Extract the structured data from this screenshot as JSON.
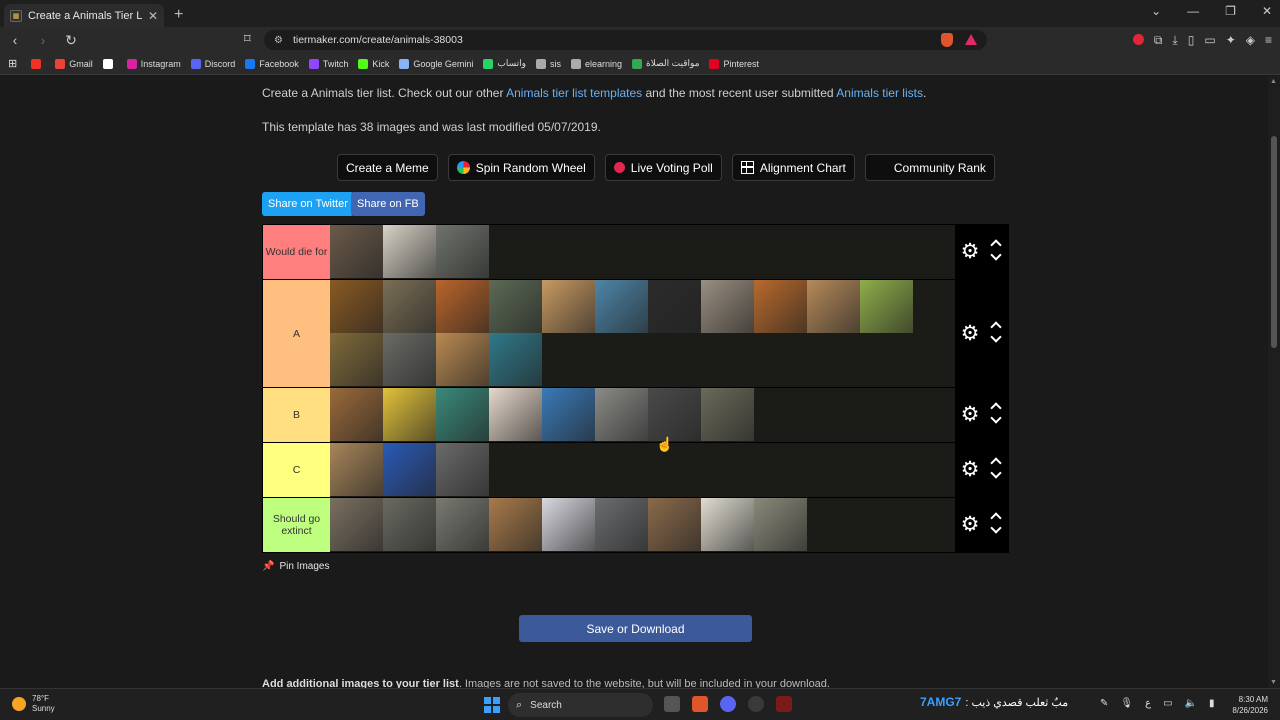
{
  "browser": {
    "tab_title": "Create a Animals Tier List - TierM",
    "tab_close": "✕",
    "new_tab": "+",
    "url": "tiermaker.com/create/animals-38003",
    "window_controls": [
      "⌄",
      "—",
      "❐",
      "✕"
    ]
  },
  "bookmarks": [
    {
      "label": "",
      "color": "#e32"
    },
    {
      "label": "Gmail",
      "color": "#ea4335"
    },
    {
      "label": "",
      "color": "#ffffff"
    },
    {
      "label": "Instagram",
      "color": "#d6249f"
    },
    {
      "label": "Discord",
      "color": "#5865f2"
    },
    {
      "label": "Facebook",
      "color": "#1877f2"
    },
    {
      "label": "Twitch",
      "color": "#9146ff"
    },
    {
      "label": "Kick",
      "color": "#53fc18"
    },
    {
      "label": "Google Gemini",
      "color": "#8ab4f8"
    },
    {
      "label": "واتساب",
      "color": "#25d366"
    },
    {
      "label": "sis",
      "color": "#aaaaaa"
    },
    {
      "label": "elearning",
      "color": "#aaaaaa"
    },
    {
      "label": "مواقيت الصلاة",
      "color": "#34a853"
    },
    {
      "label": "Pinterest",
      "color": "#e60023"
    }
  ],
  "intro": {
    "prefix": "Create a Animals tier list. Check out our other ",
    "link1": "Animals tier list templates",
    "middle": " and the most recent user submitted ",
    "link2": "Animals tier lists",
    "suffix": "."
  },
  "meta_text": "This template has 38 images and was last modified 05/07/2019.",
  "tools": {
    "meme": "Create a Meme",
    "wheel": "Spin Random Wheel",
    "poll": "Live Voting Poll",
    "alignment": "Alignment Chart",
    "community": "Community Rank"
  },
  "share": {
    "twitter": "Share on Twitter",
    "fb": "Share on FB"
  },
  "tiers": [
    {
      "label": "Would die for",
      "color": "#ff7f7f",
      "images": [
        "#6b5a4a",
        "#d8d2c6",
        "#6f746c"
      ]
    },
    {
      "label": "A",
      "color": "#ffbf7f",
      "images": [
        "#8a5a22",
        "#7a6e55",
        "#b9652a",
        "#5c6a55",
        "#c79a62",
        "#4d86a8",
        "#2b2b2b",
        "#9a8f80",
        "#b86a2c",
        "#b58a5a",
        "#8fae4a",
        "#7f6a3a",
        "#6a6a66",
        "#b98a52",
        "#2f7a8a"
      ]
    },
    {
      "label": "B",
      "color": "#ffdf7f",
      "images": [
        "#9a6a3a",
        "#e2c23a",
        "#3a8a7a",
        "#e6d8cc",
        "#3a7ab8",
        "#8a8a86",
        "#4a4a4a",
        "#6a6a5a"
      ]
    },
    {
      "label": "C",
      "color": "#ffff7f",
      "images": [
        "#a8865a",
        "#2a5ab8",
        "#6a6a6a"
      ]
    },
    {
      "label": "Should go extinct",
      "color": "#bfff7f",
      "images": [
        "#7a7060",
        "#6a6a62",
        "#7a7a72",
        "#a87a4a",
        "#d8d8e0",
        "#6a6e70",
        "#8a6a4a",
        "#e0dcd0",
        "#8a8a7a"
      ]
    }
  ],
  "pin_label": "Pin Images",
  "save_label": "Save or Download",
  "add_images": {
    "bold": "Add additional images to your tier list",
    "rest": ". Images are not saved to the website, but will be included in your download."
  },
  "taskbar": {
    "temp": "78°F",
    "condition": "Sunny",
    "search": "Search",
    "tray_name": "7AMG7",
    "tray_text": ": مبٌ ثعلب قصدي ذيب",
    "time": "8:30 AM",
    "date": "8/26/2026"
  }
}
